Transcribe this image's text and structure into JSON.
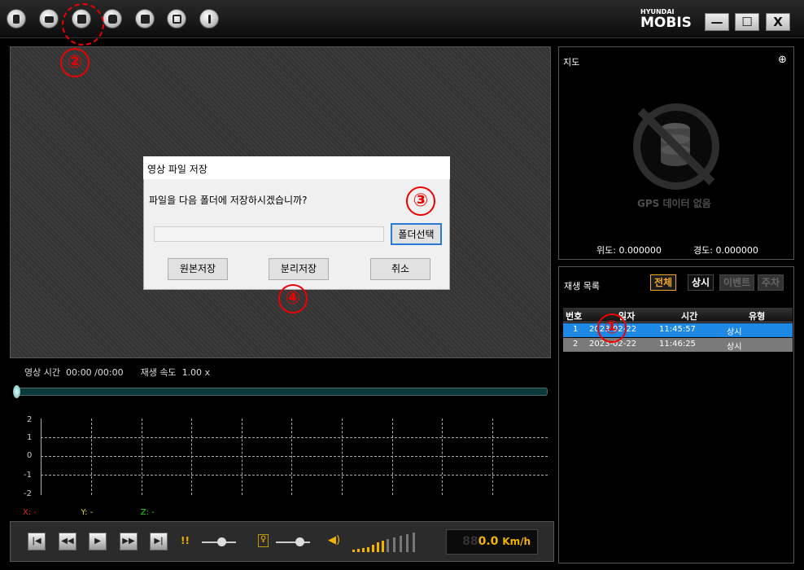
{
  "logo": {
    "top": "HYUNDAI",
    "main": "MOBIS"
  },
  "window": {
    "min": "—",
    "max": "☐",
    "close": "X"
  },
  "video": {
    "time_label": "영상 시간",
    "time": "00:00 /00:00",
    "speed_label": "재생 속도",
    "speed": "1.00 x"
  },
  "graph": {
    "y_labels": [
      "2",
      "1",
      "0",
      "-1",
      "-2"
    ],
    "x_label": "X:",
    "x_val": "-",
    "y_label": "Y:",
    "y_val": "-",
    "z_label": "Z:",
    "z_val": "-"
  },
  "speedometer": {
    "ghost": "88",
    "value": "0.0",
    "unit": "Km/h"
  },
  "map": {
    "title": "지도",
    "zoom_icon": "⊕",
    "no_gps": "GPS 데이터 없음",
    "lat": "위도: 0.000000",
    "lon": "경도: 0.000000"
  },
  "playlist": {
    "title": "재생 목록",
    "tabs": [
      "전체",
      "상시",
      "이벤트",
      "주차"
    ],
    "headers": [
      "번호",
      "일자",
      "시간",
      "유형"
    ],
    "rows": [
      {
        "no": "1",
        "date": "2023-02-22",
        "time": "11:45:57",
        "type": "상시"
      },
      {
        "no": "2",
        "date": "2023-02-22",
        "time": "11:46:25",
        "type": "상시"
      }
    ]
  },
  "dialog": {
    "title": "영상 파일 저장",
    "message": "파일을 다음 폴더에 저장하시겠습니까?",
    "path": "",
    "folder_button": "폴더선택",
    "save_original": "원본저장",
    "save_split": "분리저장",
    "cancel": "취소"
  },
  "annotations": [
    "①",
    "②",
    "③",
    "④"
  ],
  "colors": {
    "accent": "#1e88e5",
    "tab_active": "#f5a623",
    "annotation": "#e00000",
    "speed": "#f2b400"
  }
}
